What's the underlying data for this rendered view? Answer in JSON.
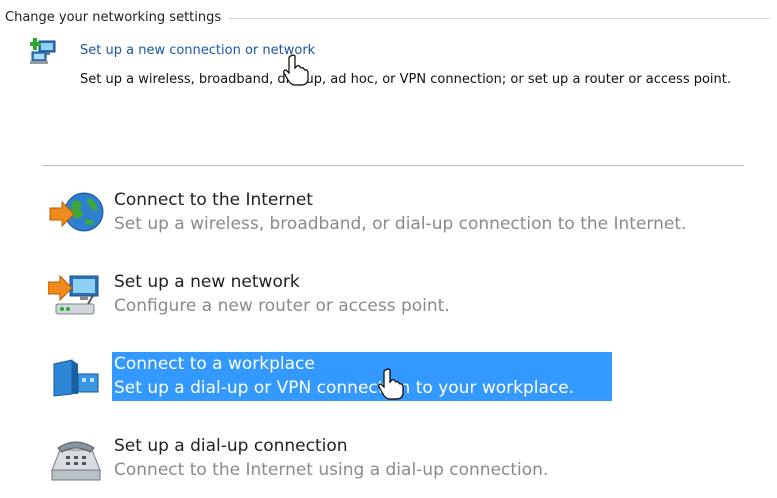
{
  "section": {
    "title": "Change your networking settings"
  },
  "task": {
    "link": "Set up a new connection or network",
    "description": "Set up a wireless, broadband, dial-up, ad hoc, or VPN connection; or set up a router or access point.",
    "icon": "network-add-icon"
  },
  "options": [
    {
      "title": "Connect to the Internet",
      "description": "Set up a wireless, broadband, or dial-up connection to the Internet.",
      "icon": "globe-icon",
      "selected": false
    },
    {
      "title": "Set up a new network",
      "description": "Configure a new router or access point.",
      "icon": "router-icon",
      "selected": false
    },
    {
      "title": "Connect to a workplace",
      "description": "Set up a dial-up or VPN connection to your workplace.",
      "icon": "workplace-icon",
      "selected": true
    },
    {
      "title": "Set up a dial-up connection",
      "description": "Connect to the Internet using a dial-up connection.",
      "icon": "phone-icon",
      "selected": false
    }
  ],
  "colors": {
    "link": "#1a56a8",
    "selection": "#3399ff",
    "description_gray": "#8a8a8a"
  }
}
